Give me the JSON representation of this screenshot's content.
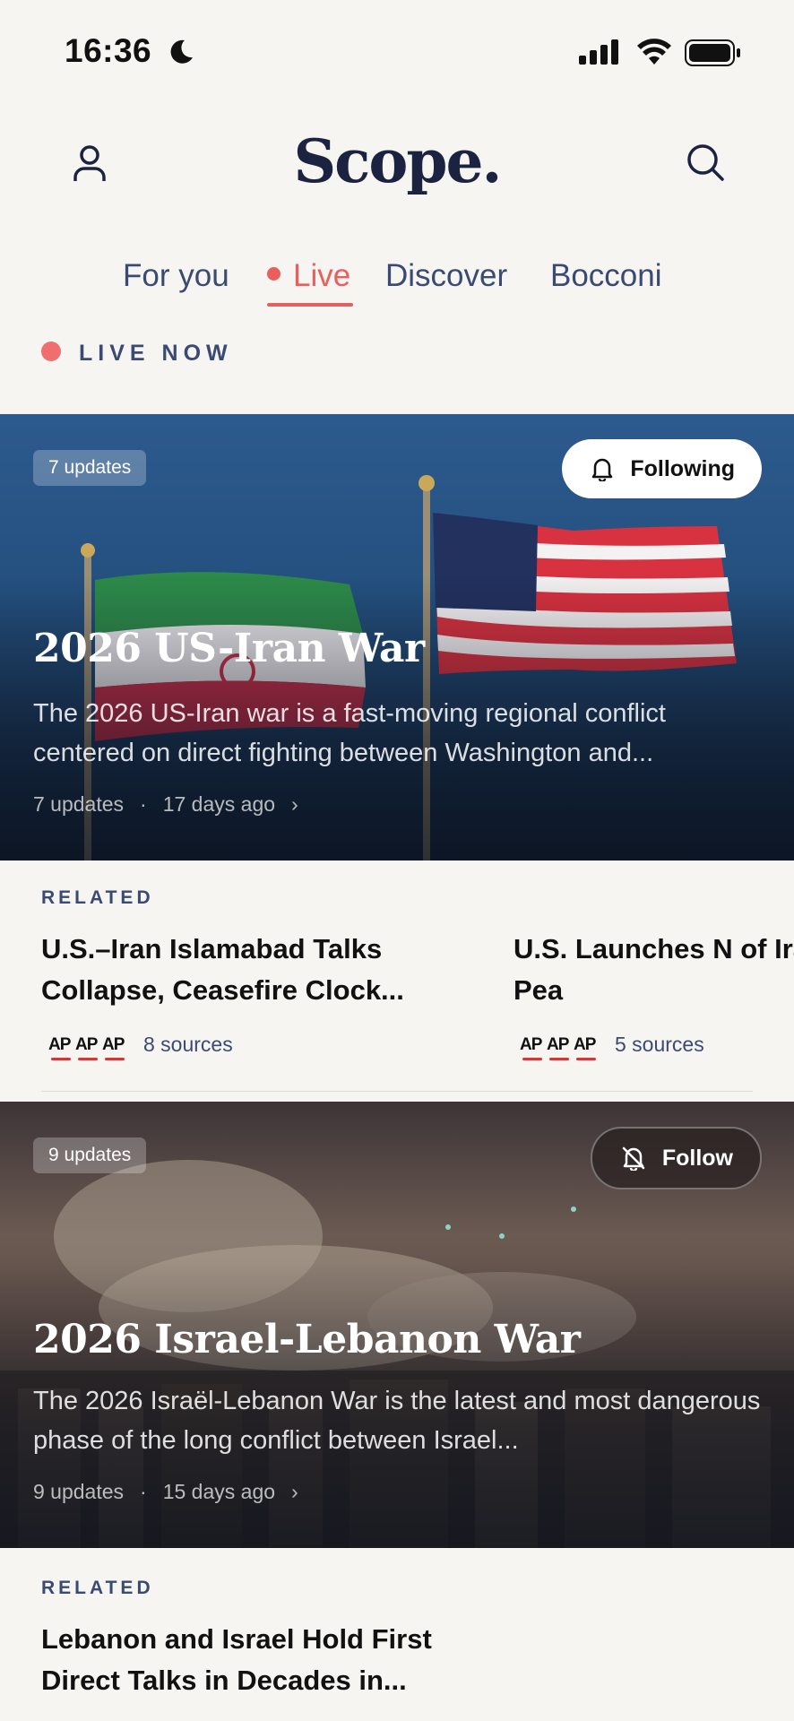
{
  "status_bar": {
    "time": "16:36"
  },
  "header": {
    "logo": "Scope."
  },
  "tabs": [
    {
      "label": "For you"
    },
    {
      "label": "Live"
    },
    {
      "label": "Discover"
    },
    {
      "label": "Bocconi"
    }
  ],
  "section_label": "LIVE NOW",
  "stories": [
    {
      "badge": "7 updates",
      "follow_label": "Following",
      "title": "2026 US-Iran War",
      "description": "The 2026 US-Iran war is a fast-moving regional conflict centered on direct fighting between Washington and...",
      "updates": "7 updates",
      "age": "17 days ago",
      "related_label": "RELATED",
      "related": [
        {
          "headline": "U.S.–Iran Islamabad Talks Collapse, Ceasefire Clock...",
          "sources": "8 sources"
        },
        {
          "headline": "U.S. Launches N of Iran After Pea",
          "sources": "5 sources"
        }
      ]
    },
    {
      "badge": "9 updates",
      "follow_label": "Follow",
      "title": "2026 Israel-Lebanon War",
      "description": "The 2026 Israël-Lebanon War is the latest and most dangerous phase of the long conflict between Israel...",
      "updates": "9 updates",
      "age": "15 days ago",
      "related_label": "RELATED",
      "related": [
        {
          "headline": "Lebanon and Israel Hold First Direct Talks in Decades in..."
        }
      ]
    }
  ],
  "source_logo_text": "AP",
  "colors": {
    "accent": "#e8605e",
    "navy": "#1b2340",
    "muted": "#3a4a72",
    "background": "#f6f5f1"
  }
}
